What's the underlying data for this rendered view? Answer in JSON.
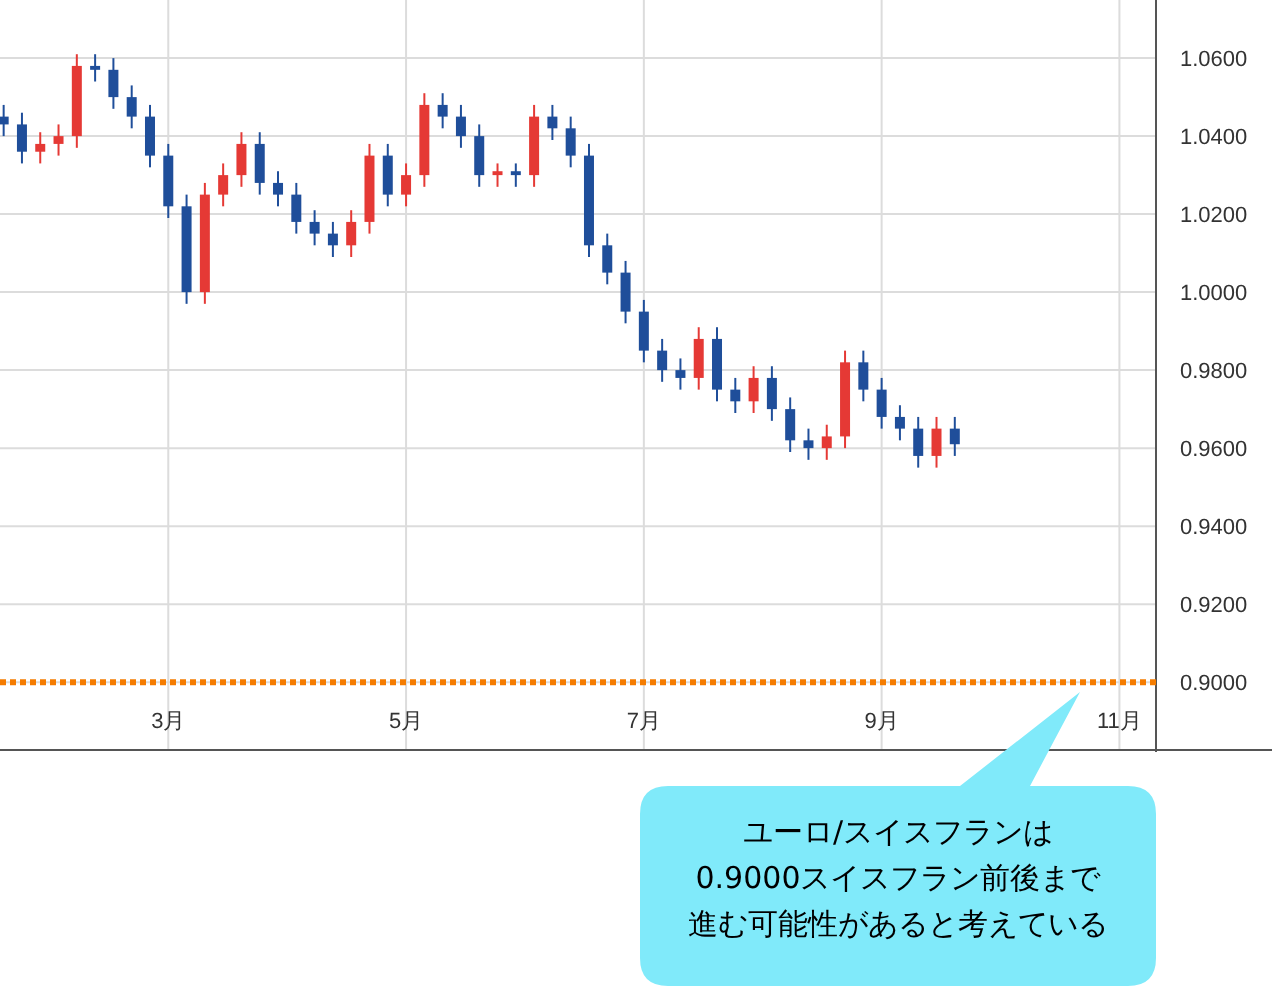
{
  "chart_data": {
    "type": "candlestick",
    "grid": true,
    "ylim": [
      0.8826,
      1.0749
    ],
    "yticks": [
      {
        "value": 1.06,
        "label": "1.0600"
      },
      {
        "value": 1.04,
        "label": "1.0400"
      },
      {
        "value": 1.02,
        "label": "1.0200"
      },
      {
        "value": 1.0,
        "label": "1.0000"
      },
      {
        "value": 0.98,
        "label": "0.9800"
      },
      {
        "value": 0.96,
        "label": "0.9600"
      },
      {
        "value": 0.94,
        "label": "0.9400"
      },
      {
        "value": 0.92,
        "label": "0.9200"
      },
      {
        "value": 0.9,
        "label": "0.9000"
      }
    ],
    "categories": [
      null,
      null,
      null,
      null,
      null,
      null,
      null,
      null,
      null,
      "3月",
      null,
      null,
      null,
      null,
      null,
      null,
      null,
      null,
      null,
      null,
      null,
      null,
      "5月",
      null,
      null,
      null,
      null,
      null,
      null,
      null,
      null,
      null,
      null,
      null,
      null,
      "7月",
      null,
      null,
      null,
      null,
      null,
      null,
      null,
      null,
      null,
      null,
      null,
      null,
      "9月",
      null,
      null,
      null,
      null,
      null,
      null,
      null,
      null,
      null,
      null,
      null,
      null,
      "11月",
      null
    ],
    "ohlc": [
      [
        1.045,
        1.048,
        1.04,
        1.043
      ],
      [
        1.043,
        1.046,
        1.033,
        1.036
      ],
      [
        1.036,
        1.041,
        1.033,
        1.038
      ],
      [
        1.038,
        1.043,
        1.035,
        1.04
      ],
      [
        1.04,
        1.061,
        1.037,
        1.058
      ],
      [
        1.058,
        1.061,
        1.054,
        1.057
      ],
      [
        1.057,
        1.06,
        1.047,
        1.05
      ],
      [
        1.05,
        1.053,
        1.042,
        1.045
      ],
      [
        1.045,
        1.048,
        1.032,
        1.035
      ],
      [
        1.035,
        1.038,
        1.019,
        1.022
      ],
      [
        1.022,
        1.025,
        0.997,
        1.0
      ],
      [
        1.0,
        1.028,
        0.997,
        1.025
      ],
      [
        1.025,
        1.033,
        1.022,
        1.03
      ],
      [
        1.03,
        1.041,
        1.027,
        1.038
      ],
      [
        1.038,
        1.041,
        1.025,
        1.028
      ],
      [
        1.028,
        1.031,
        1.022,
        1.025
      ],
      [
        1.025,
        1.028,
        1.015,
        1.018
      ],
      [
        1.018,
        1.021,
        1.012,
        1.015
      ],
      [
        1.015,
        1.018,
        1.009,
        1.012
      ],
      [
        1.012,
        1.021,
        1.009,
        1.018
      ],
      [
        1.018,
        1.038,
        1.015,
        1.035
      ],
      [
        1.035,
        1.038,
        1.022,
        1.025
      ],
      [
        1.025,
        1.033,
        1.022,
        1.03
      ],
      [
        1.03,
        1.051,
        1.027,
        1.048
      ],
      [
        1.048,
        1.051,
        1.042,
        1.045
      ],
      [
        1.045,
        1.048,
        1.037,
        1.04
      ],
      [
        1.04,
        1.043,
        1.027,
        1.03
      ],
      [
        1.03,
        1.033,
        1.027,
        1.031
      ],
      [
        1.031,
        1.033,
        1.027,
        1.03
      ],
      [
        1.03,
        1.048,
        1.027,
        1.045
      ],
      [
        1.045,
        1.048,
        1.039,
        1.042
      ],
      [
        1.042,
        1.045,
        1.032,
        1.035
      ],
      [
        1.035,
        1.038,
        1.009,
        1.012
      ],
      [
        1.012,
        1.015,
        1.002,
        1.005
      ],
      [
        1.005,
        1.008,
        0.992,
        0.995
      ],
      [
        0.995,
        0.998,
        0.982,
        0.985
      ],
      [
        0.985,
        0.988,
        0.977,
        0.98
      ],
      [
        0.98,
        0.983,
        0.975,
        0.978
      ],
      [
        0.978,
        0.991,
        0.975,
        0.988
      ],
      [
        0.988,
        0.991,
        0.972,
        0.975
      ],
      [
        0.975,
        0.978,
        0.969,
        0.972
      ],
      [
        0.972,
        0.981,
        0.969,
        0.978
      ],
      [
        0.978,
        0.981,
        0.967,
        0.97
      ],
      [
        0.97,
        0.973,
        0.959,
        0.962
      ],
      [
        0.962,
        0.965,
        0.957,
        0.96
      ],
      [
        0.96,
        0.966,
        0.957,
        0.963
      ],
      [
        0.963,
        0.985,
        0.96,
        0.982
      ],
      [
        0.982,
        0.985,
        0.972,
        0.975
      ],
      [
        0.975,
        0.978,
        0.965,
        0.968
      ],
      [
        0.968,
        0.971,
        0.962,
        0.965
      ],
      [
        0.965,
        0.968,
        0.955,
        0.958
      ],
      [
        0.958,
        0.968,
        0.955,
        0.965
      ],
      [
        0.965,
        0.968,
        0.958,
        0.961
      ],
      null,
      null,
      null,
      null,
      null,
      null,
      null,
      null,
      null,
      null
    ],
    "ref_lines": [
      {
        "axis": "y",
        "value": 0.9,
        "color": "#f57c00"
      }
    ]
  },
  "callout": {
    "lines": [
      "ユーロ/スイスフランは",
      "0.9000スイスフラン前後まで",
      "進む可能性があると考えている"
    ]
  }
}
